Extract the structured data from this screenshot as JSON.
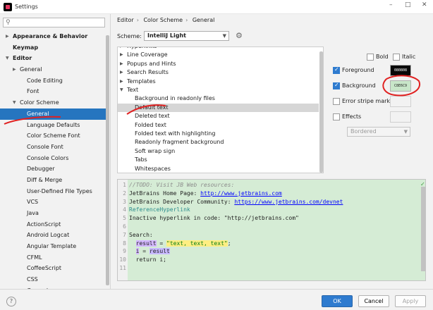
{
  "window": {
    "title": "Settings",
    "controls": [
      "–",
      "□",
      "✕"
    ]
  },
  "sidebar": {
    "search_placeholder": "",
    "items": [
      {
        "label": "Appearance & Behavior",
        "indent": 0,
        "arrow": "▶",
        "bold": true
      },
      {
        "label": "Keymap",
        "indent": 0,
        "arrow": "",
        "bold": true
      },
      {
        "label": "Editor",
        "indent": 0,
        "arrow": "▼",
        "bold": true
      },
      {
        "label": "General",
        "indent": 1,
        "arrow": "▶",
        "bold": false
      },
      {
        "label": "Code Editing",
        "indent": 2,
        "arrow": "",
        "bold": false
      },
      {
        "label": "Font",
        "indent": 2,
        "arrow": "",
        "bold": false
      },
      {
        "label": "Color Scheme",
        "indent": 1,
        "arrow": "▼",
        "bold": false
      },
      {
        "label": "General",
        "indent": 2,
        "arrow": "",
        "bold": false,
        "selected": true
      },
      {
        "label": "Language Defaults",
        "indent": 3,
        "arrow": "",
        "bold": false
      },
      {
        "label": "Color Scheme Font",
        "indent": 3,
        "arrow": "",
        "bold": false
      },
      {
        "label": "Console Font",
        "indent": 3,
        "arrow": "",
        "bold": false
      },
      {
        "label": "Console Colors",
        "indent": 3,
        "arrow": "",
        "bold": false
      },
      {
        "label": "Debugger",
        "indent": 3,
        "arrow": "",
        "bold": false
      },
      {
        "label": "Diff & Merge",
        "indent": 3,
        "arrow": "",
        "bold": false
      },
      {
        "label": "User-Defined File Types",
        "indent": 3,
        "arrow": "",
        "bold": false
      },
      {
        "label": "VCS",
        "indent": 3,
        "arrow": "",
        "bold": false
      },
      {
        "label": "Java",
        "indent": 3,
        "arrow": "",
        "bold": false
      },
      {
        "label": "ActionScript",
        "indent": 3,
        "arrow": "",
        "bold": false
      },
      {
        "label": "Android Logcat",
        "indent": 3,
        "arrow": "",
        "bold": false
      },
      {
        "label": "Angular Template",
        "indent": 3,
        "arrow": "",
        "bold": false
      },
      {
        "label": "CFML",
        "indent": 3,
        "arrow": "",
        "bold": false
      },
      {
        "label": "CoffeeScript",
        "indent": 3,
        "arrow": "",
        "bold": false
      },
      {
        "label": "CSS",
        "indent": 3,
        "arrow": "",
        "bold": false
      },
      {
        "label": "Cucumber",
        "indent": 3,
        "arrow": "",
        "bold": false
      }
    ]
  },
  "breadcrumb": [
    "Editor",
    "Color Scheme",
    "General"
  ],
  "scheme": {
    "label": "Scheme:",
    "value": "IntelliJ Light"
  },
  "attributes_list": [
    {
      "label": "Hyperlinks",
      "level": 0,
      "arrow": "▶"
    },
    {
      "label": "Line Coverage",
      "level": 0,
      "arrow": "▶"
    },
    {
      "label": "Popups and Hints",
      "level": 0,
      "arrow": "▶"
    },
    {
      "label": "Search Results",
      "level": 0,
      "arrow": "▶"
    },
    {
      "label": "Templates",
      "level": 0,
      "arrow": "▶"
    },
    {
      "label": "Text",
      "level": 0,
      "arrow": "▼"
    },
    {
      "label": "Background in readonly files",
      "level": 1,
      "arrow": ""
    },
    {
      "label": "Default text",
      "level": 1,
      "arrow": "",
      "selected": true
    },
    {
      "label": "Deleted text",
      "level": 1,
      "arrow": ""
    },
    {
      "label": "Folded text",
      "level": 1,
      "arrow": ""
    },
    {
      "label": "Folded text with highlighting",
      "level": 1,
      "arrow": ""
    },
    {
      "label": "Readonly fragment background",
      "level": 1,
      "arrow": ""
    },
    {
      "label": "Soft wrap sign",
      "level": 1,
      "arrow": ""
    },
    {
      "label": "Tabs",
      "level": 1,
      "arrow": ""
    },
    {
      "label": "Whitespaces",
      "level": 1,
      "arrow": ""
    }
  ],
  "options": {
    "bold": {
      "label": "Bold",
      "checked": false
    },
    "italic": {
      "label": "Italic",
      "checked": false
    },
    "foreground": {
      "label": "Foreground",
      "checked": true,
      "value": "080808",
      "color": "#080808",
      "text_color": "#ffffff"
    },
    "background": {
      "label": "Background",
      "checked": true,
      "value": "C8E6C9",
      "color": "#c8e6c9",
      "text_color": "#222222"
    },
    "error_stripe": {
      "label": "Error stripe mark",
      "checked": false
    },
    "effects": {
      "label": "Effects",
      "checked": false,
      "select_value": "Bordered"
    }
  },
  "preview": {
    "lines": [
      {
        "num": "1",
        "parts": [
          {
            "t": "//TODO: Visit JB Web resources:",
            "c": "comment"
          }
        ]
      },
      {
        "num": "2",
        "parts": [
          {
            "t": "JetBrains Home Page: ",
            "c": ""
          },
          {
            "t": "http://www.jetbrains.com",
            "c": "link"
          }
        ]
      },
      {
        "num": "3",
        "parts": [
          {
            "t": "JetBrains Developer Community: ",
            "c": ""
          },
          {
            "t": "https://www.jetbrains.com/devnet",
            "c": "link"
          }
        ]
      },
      {
        "num": "4",
        "parts": [
          {
            "t": "ReferenceHyperlink",
            "c": "ident"
          }
        ]
      },
      {
        "num": "5",
        "parts": [
          {
            "t": "Inactive hyperlink in code: \"http://jetbrains.com\"",
            "c": ""
          }
        ]
      },
      {
        "num": "6",
        "parts": [
          {
            "t": "",
            "c": ""
          }
        ]
      },
      {
        "num": "7",
        "parts": [
          {
            "t": "Search:",
            "c": ""
          }
        ]
      },
      {
        "num": "8",
        "parts": [
          {
            "t": "  ",
            "c": ""
          },
          {
            "t": "result",
            "c": "hl-var2"
          },
          {
            "t": " = ",
            "c": ""
          },
          {
            "t": "\"text, text, text\"",
            "c": "str-hl"
          },
          {
            "t": ";",
            "c": ""
          }
        ]
      },
      {
        "num": "9",
        "parts": [
          {
            "t": "  ",
            "c": ""
          },
          {
            "t": "i",
            "c": "hl-var2"
          },
          {
            "t": " = ",
            "c": ""
          },
          {
            "t": "result",
            "c": "hl-var"
          }
        ]
      },
      {
        "num": "10",
        "parts": [
          {
            "t": "  return i;",
            "c": ""
          }
        ]
      },
      {
        "num": "11",
        "parts": [
          {
            "t": "",
            "c": ""
          }
        ]
      }
    ],
    "status": "✓"
  },
  "buttons": {
    "ok": "OK",
    "cancel": "Cancel",
    "apply": "Apply",
    "help": "?"
  },
  "colors": {
    "accent": "#2e7bcf",
    "selection": "#2675bf",
    "annotation": "#e02020"
  }
}
